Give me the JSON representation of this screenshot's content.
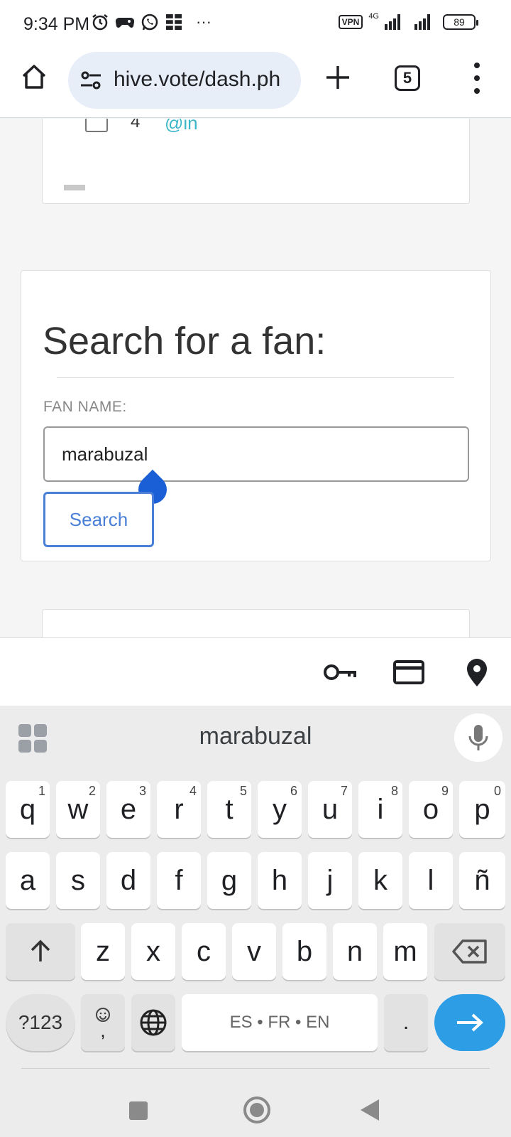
{
  "status_bar": {
    "time": "9:34 PM",
    "left_icons": [
      "alarm-icon",
      "gamepad-icon",
      "whatsapp-icon",
      "grid-icon",
      "more-icon"
    ],
    "more": "···",
    "vpn": "VPN",
    "network": "4G",
    "battery": "89"
  },
  "browser": {
    "url": "hive.vote/dash.ph",
    "tab_count": "5"
  },
  "list_row": {
    "number": "4",
    "user": "@in"
  },
  "search_card": {
    "title": "Search for a fan:",
    "label": "FAN NAME:",
    "input_value": "marabuzal",
    "button_label": "Search"
  },
  "autofill_bar": {
    "icons": [
      "key-icon",
      "credit-card-icon",
      "location-pin-icon"
    ]
  },
  "keyboard": {
    "suggestion": "marabuzal",
    "row1": [
      {
        "key": "q",
        "hint": "1"
      },
      {
        "key": "w",
        "hint": "2"
      },
      {
        "key": "e",
        "hint": "3"
      },
      {
        "key": "r",
        "hint": "4"
      },
      {
        "key": "t",
        "hint": "5"
      },
      {
        "key": "y",
        "hint": "6"
      },
      {
        "key": "u",
        "hint": "7"
      },
      {
        "key": "i",
        "hint": "8"
      },
      {
        "key": "o",
        "hint": "9"
      },
      {
        "key": "p",
        "hint": "0"
      }
    ],
    "row2": [
      "a",
      "s",
      "d",
      "f",
      "g",
      "h",
      "j",
      "k",
      "l",
      "ñ"
    ],
    "row3": [
      "z",
      "x",
      "c",
      "v",
      "b",
      "n",
      "m"
    ],
    "symbols_key": "?123",
    "emoji_comma": ",",
    "space_label": "ES • FR • EN",
    "period": "."
  }
}
